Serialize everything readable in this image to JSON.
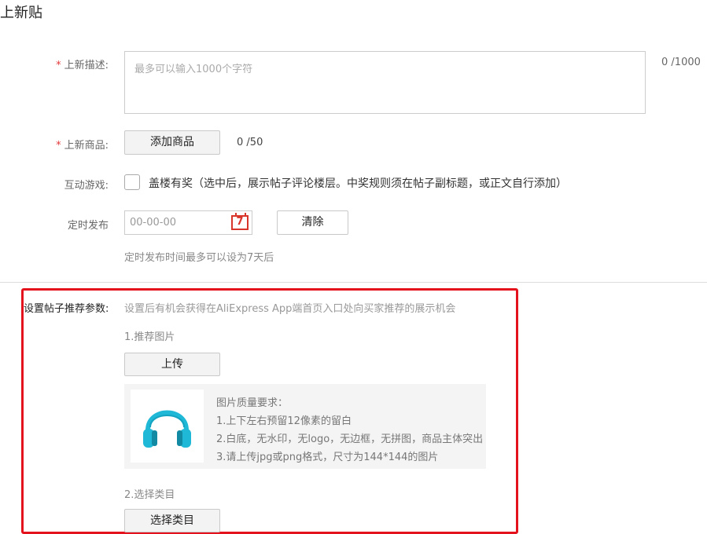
{
  "page": {
    "title": "上新贴"
  },
  "description": {
    "required_mark": "*",
    "label": "上新描述:",
    "placeholder": "最多可以输入1000个字符",
    "counter_current": "0",
    "counter_max": "/1000"
  },
  "products": {
    "required_mark": "*",
    "label": "上新商品:",
    "add_button": "添加商品",
    "counter_current": "0",
    "counter_max": "/50"
  },
  "game": {
    "label": "互动游戏:",
    "checkbox_label": "盖楼有奖（选中后，展示帖子评论楼层。中奖规则须在帖子副标题，或正文自行添加）"
  },
  "schedule": {
    "label": "定时发布",
    "placeholder": "00-00-00",
    "calendar_day": "7",
    "clear_button": "清除",
    "hint": "定时发布时间最多可以设为7天后"
  },
  "recommend": {
    "label": "设置帖子推荐参数:",
    "description": "设置后有机会获得在AliExpress App端首页入口处向买家推荐的展示机会",
    "image_section_title": "1.推荐图片",
    "upload_button": "上传",
    "requirements_title": "图片质量要求：",
    "requirements": [
      "1.上下左右预留12像素的留白",
      "2.白底，无水印，无logo，无边框，无拼图，商品主体突出",
      "3.请上传jpg或png格式，尺寸为144*144的图片"
    ],
    "category_section_title": "2.选择类目",
    "category_button": "选择类目"
  },
  "colors": {
    "required": "#e4393c",
    "highlight_frame": "#e4121d",
    "headphone": "#1fb8d6"
  }
}
